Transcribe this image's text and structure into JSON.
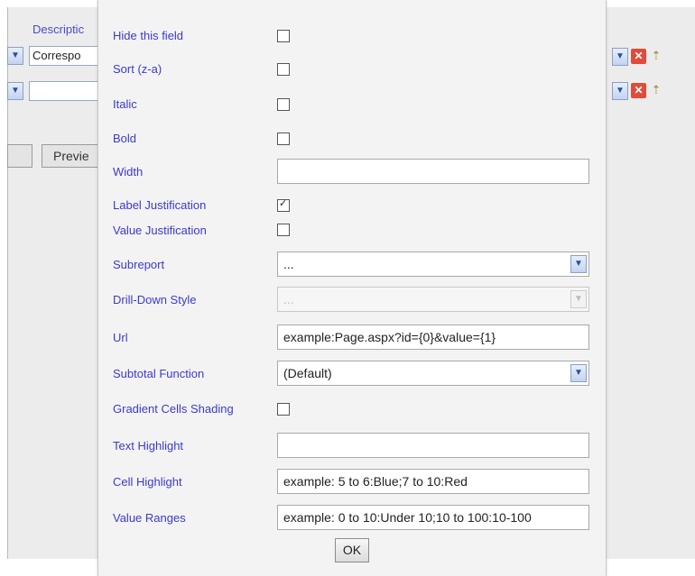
{
  "background": {
    "description_label": "Descriptic",
    "field1_value": "Correspo",
    "field2_value": "",
    "preview_label": "Previe"
  },
  "dialog": {
    "rows": {
      "hide_field": "Hide this field",
      "sort": "Sort (z-a)",
      "italic": "Italic",
      "bold": "Bold",
      "width": "Width",
      "label_justification": "Label Justification",
      "value_justification": "Value Justification",
      "subreport": "Subreport",
      "drilldown_style": "Drill-Down Style",
      "url": "Url",
      "subtotal_function": "Subtotal Function",
      "gradient_cells_shading": "Gradient Cells Shading",
      "text_highlight": "Text Highlight",
      "cell_highlight": "Cell Highlight",
      "value_ranges": "Value Ranges"
    },
    "values": {
      "width": "",
      "subreport": "...",
      "drilldown_style": "...",
      "url": "example:Page.aspx?id={0}&value={1}",
      "subtotal_function": "(Default)",
      "text_highlight": "",
      "cell_highlight": "example: 5 to 6:Blue;7 to 10:Red",
      "value_ranges": "example: 0 to 10:Under 10;10 to 100:10-100"
    },
    "checked": {
      "label_justification": true
    },
    "ok_label": "OK"
  },
  "icons": {
    "dropdown": "chevron-down-icon",
    "delete": "red-x-icon",
    "move": "arrow-icon"
  },
  "colors": {
    "label": "#3a3ad0",
    "dialog_bg": "#f3f3f3",
    "page_bg": "#ececec"
  }
}
